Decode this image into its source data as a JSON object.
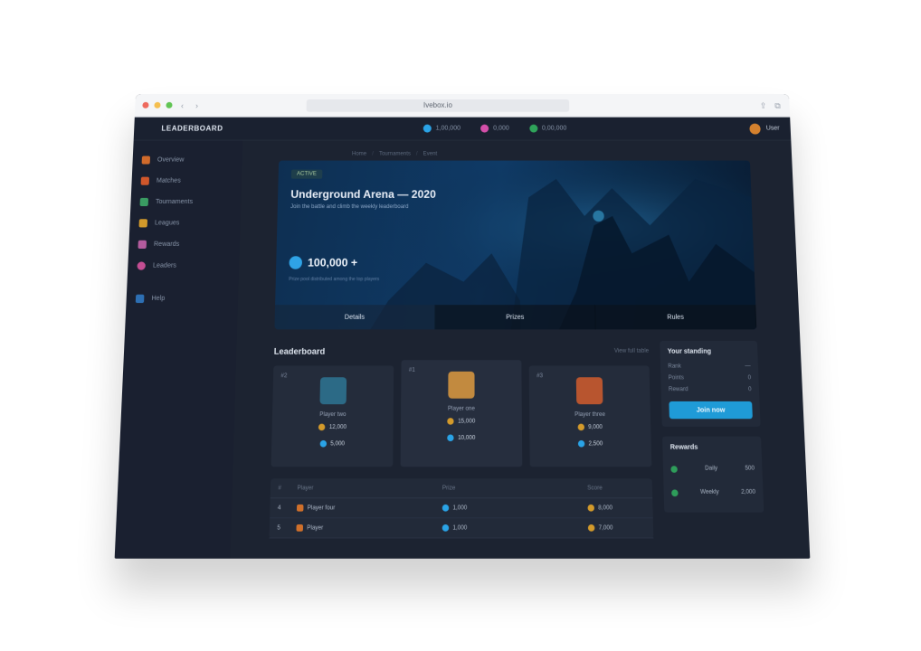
{
  "browser": {
    "url": "Ivebox.io",
    "back_icon": "chevron-left-icon",
    "forward_icon": "chevron-right-icon"
  },
  "app": {
    "brand": "LEADERBOARD",
    "top_stats": [
      {
        "label": "1,00,000",
        "color": "#2aa3e6"
      },
      {
        "label": "0,000",
        "color": "#d44fa9"
      },
      {
        "label": "0,00,000",
        "color": "#2fa35a"
      }
    ],
    "user_name": "User"
  },
  "sidebar": {
    "items": [
      {
        "label": "Overview",
        "color": "#d06a2b"
      },
      {
        "label": "Matches",
        "color": "#d0572b"
      },
      {
        "label": "Tournaments",
        "color": "#3a9c62"
      },
      {
        "label": "Leagues",
        "color": "#d39a2b"
      },
      {
        "label": "Rewards",
        "color": "#b45c9e"
      },
      {
        "label": "Leaders",
        "color": "#c44e93"
      }
    ],
    "bottom_item": {
      "label": "Help",
      "color": "#2d6fb3"
    }
  },
  "crumbs": [
    "Home",
    "Tournaments",
    "Event"
  ],
  "hero": {
    "tag": "ACTIVE",
    "title": "Underground Arena — 2020",
    "subtitle": "Join the battle and climb the weekly leaderboard",
    "prize": "100,000 +",
    "note": "Prize pool distributed among the top players",
    "tabs": [
      "Details",
      "Prizes",
      "Rules"
    ]
  },
  "leaderboard": {
    "title": "Leaderboard",
    "view_all": "View full table",
    "podium": [
      {
        "rank": "#2",
        "name": "Player two",
        "score": "12,000",
        "prize": "5,000",
        "img_color": "#2c6a86"
      },
      {
        "rank": "#1",
        "name": "Player one",
        "score": "15,000",
        "prize": "10,000",
        "img_color": "#c28a3f"
      },
      {
        "rank": "#3",
        "name": "Player three",
        "score": "9,000",
        "prize": "2,500",
        "img_color": "#b8552f"
      }
    ],
    "columns": [
      "#",
      "Player",
      "Prize",
      "Score"
    ],
    "rows": [
      {
        "rank": "4",
        "player": "Player four",
        "prize": "1,000",
        "score": "8,000"
      },
      {
        "rank": "5",
        "player": "Player",
        "prize": "1,000",
        "score": "7,000"
      }
    ]
  },
  "right_panel": {
    "title": "Your standing",
    "rows": [
      {
        "k": "Rank",
        "v": "—"
      },
      {
        "k": "Points",
        "v": "0"
      },
      {
        "k": "Reward",
        "v": "0"
      }
    ],
    "cta": "Join now",
    "second_title": "Rewards",
    "second_rows": [
      {
        "label": "Daily",
        "value": "500"
      },
      {
        "label": "Weekly",
        "value": "2,000"
      }
    ]
  }
}
